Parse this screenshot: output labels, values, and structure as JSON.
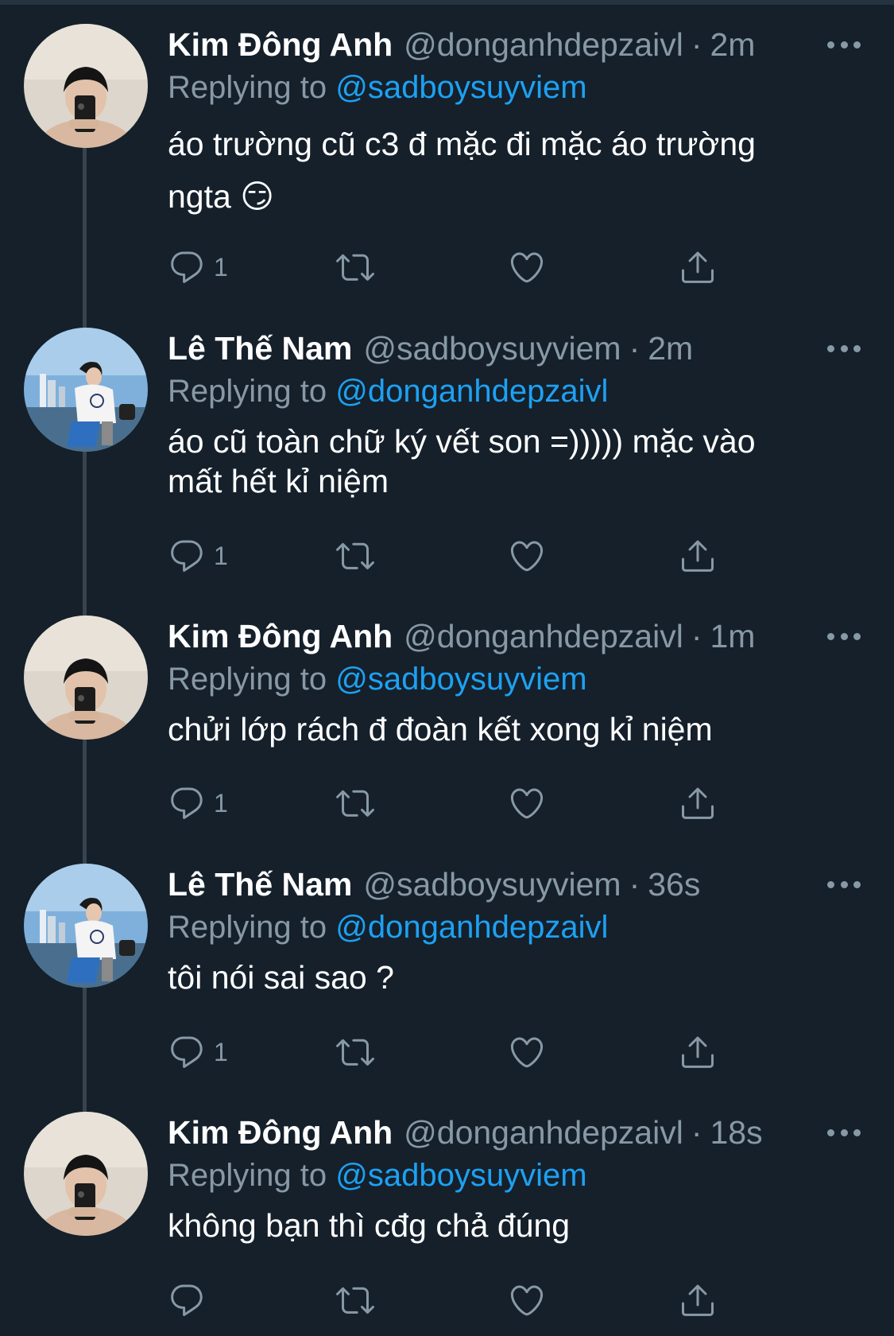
{
  "colors": {
    "background": "#15202b",
    "primary_text": "#ffffff",
    "secondary_text": "#8899a6",
    "accent": "#1da1f2",
    "thread_line": "#38444d"
  },
  "icons": {
    "reply": "reply-icon",
    "retweet": "retweet-icon",
    "like": "heart-icon",
    "share": "share-icon",
    "more": "more-icon"
  },
  "replying_prefix": "Replying to",
  "tweets": [
    {
      "name": "Kim Đông Anh",
      "handle": "@donganhdepzaivl",
      "dot": "·",
      "time": "2m",
      "replying_to": "@sadboysuyviem",
      "text": "áo trường cũ c3 đ mặc đi mặc áo trường\nngta 😏",
      "reply_count": "1"
    },
    {
      "name": "Lê Thế Nam",
      "handle": "@sadboysuyviem",
      "dot": "·",
      "time": "2m",
      "replying_to": "@donganhdepzaivl",
      "text": "áo cũ toàn chữ ký vết son =))))) mặc vào\nmất hết kỉ niệm",
      "reply_count": "1"
    },
    {
      "name": "Kim Đông Anh",
      "handle": "@donganhdepzaivl",
      "dot": "·",
      "time": "1m",
      "replying_to": "@sadboysuyviem",
      "text": "chửi lớp rách đ đoàn kết xong kỉ niệm",
      "reply_count": "1"
    },
    {
      "name": "Lê Thế Nam",
      "handle": "@sadboysuyviem",
      "dot": "·",
      "time": "36s",
      "replying_to": "@donganhdepzaivl",
      "text": "tôi nói sai sao ?",
      "reply_count": "1"
    },
    {
      "name": "Kim Đông Anh",
      "handle": "@donganhdepzaivl",
      "dot": "·",
      "time": "18s",
      "replying_to": "@sadboysuyviem",
      "text": "không bạn thì cđg chả đúng",
      "reply_count": ""
    }
  ]
}
